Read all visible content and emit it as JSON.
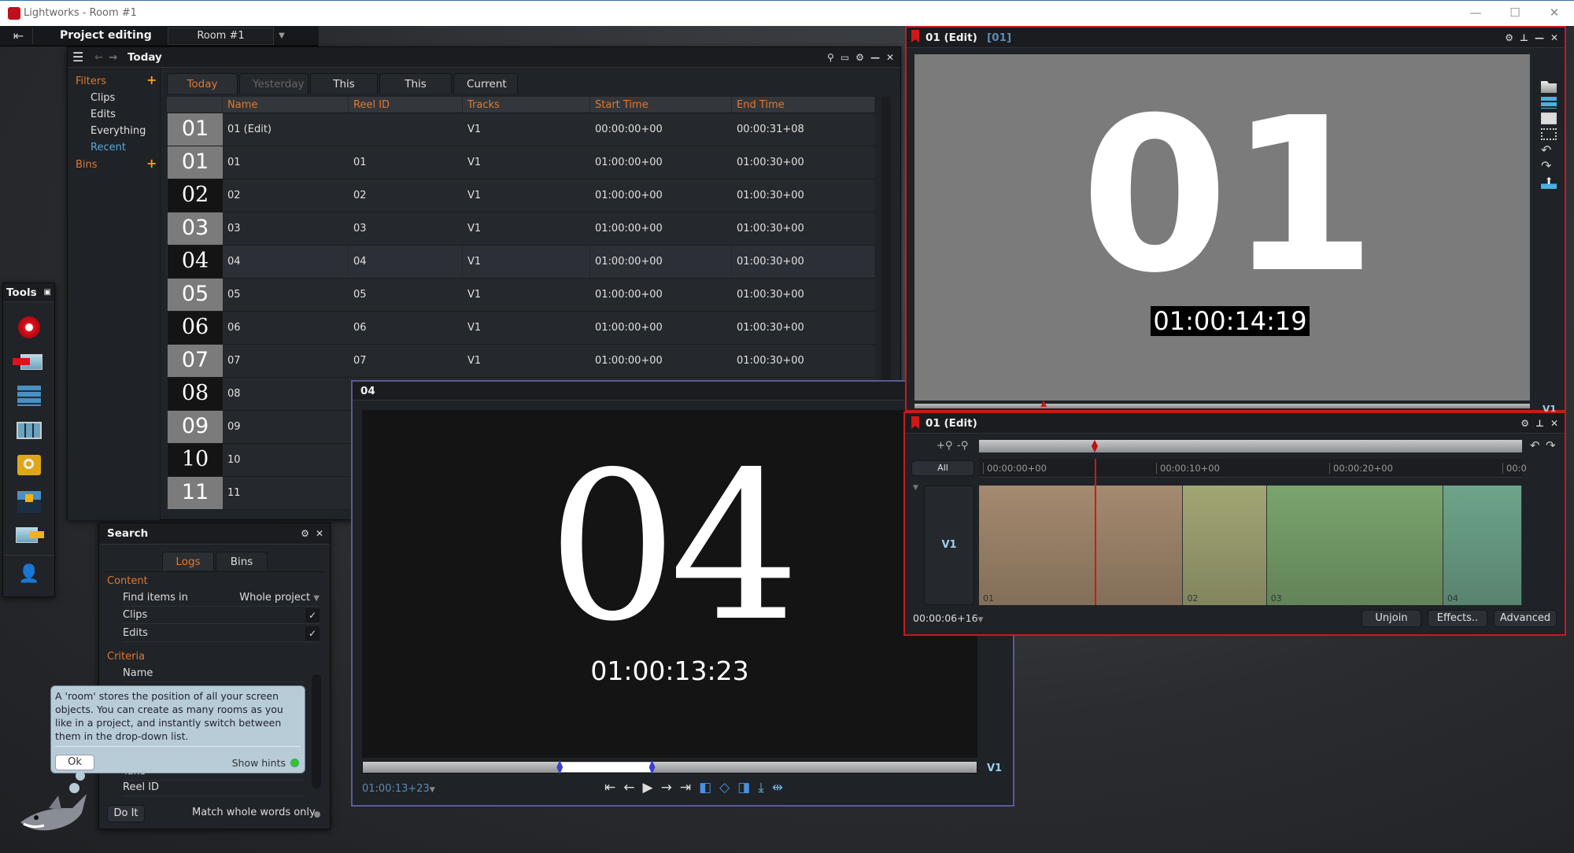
{
  "window": {
    "title": "Lightworks - Room #1",
    "minimize": "—",
    "maximize": "☐",
    "close": "✕"
  },
  "topbar": {
    "exit_icon": "⇤",
    "project_label": "Project editing",
    "room": "Room #1",
    "room_dropdown": "▼"
  },
  "browser": {
    "title": "Today",
    "header_icons": {
      "menu": "☰",
      "back": "←",
      "forward": "→",
      "search": "🔍",
      "view": "▭",
      "settings": "⚙",
      "minimize": "—",
      "close": "✕"
    },
    "filters": {
      "heading": "Filters",
      "add": "+",
      "items": [
        "Clips",
        "Edits",
        "Everything",
        "Recent"
      ],
      "active": "Recent",
      "bins_heading": "Bins",
      "bins_add": "+"
    },
    "tabs": [
      {
        "label": "Today",
        "state": "active"
      },
      {
        "label": "Yesterday",
        "state": "disabled"
      },
      {
        "label": "This week",
        "state": "normal"
      },
      {
        "label": "This month",
        "state": "normal"
      },
      {
        "label": "Current",
        "state": "normal"
      }
    ],
    "columns": [
      "",
      "Name",
      "Reel ID",
      "Tracks",
      "Start Time",
      "End Time"
    ],
    "rows": [
      {
        "thumb": "01",
        "thumb_style": "g",
        "flag": true,
        "name": "01 (Edit)",
        "reel": "",
        "tracks": "V1",
        "start": "00:00:00+00",
        "end": "00:00:31+08"
      },
      {
        "thumb": "01",
        "thumb_style": "g",
        "name": "01",
        "reel": "01",
        "tracks": "V1",
        "start": "01:00:00+00",
        "end": "01:00:30+00"
      },
      {
        "thumb": "02",
        "thumb_style": "b",
        "name": "02",
        "reel": "02",
        "tracks": "V1",
        "start": "01:00:00+00",
        "end": "01:00:30+00"
      },
      {
        "thumb": "03",
        "thumb_style": "g",
        "name": "03",
        "reel": "03",
        "tracks": "V1",
        "start": "01:00:00+00",
        "end": "01:00:30+00"
      },
      {
        "thumb": "04",
        "thumb_style": "b",
        "name": "04",
        "reel": "04",
        "tracks": "V1",
        "start": "01:00:00+00",
        "end": "01:00:30+00"
      },
      {
        "thumb": "05",
        "thumb_style": "g",
        "name": "05",
        "reel": "05",
        "tracks": "V1",
        "start": "01:00:00+00",
        "end": "01:00:30+00"
      },
      {
        "thumb": "06",
        "thumb_style": "b",
        "name": "06",
        "reel": "06",
        "tracks": "V1",
        "start": "01:00:00+00",
        "end": "01:00:30+00"
      },
      {
        "thumb": "07",
        "thumb_style": "g",
        "name": "07",
        "reel": "07",
        "tracks": "V1",
        "start": "01:00:00+00",
        "end": "01:00:30+00"
      },
      {
        "thumb": "08",
        "thumb_style": "b",
        "name": "08",
        "reel": "",
        "tracks": "",
        "start": "",
        "end": ""
      },
      {
        "thumb": "09",
        "thumb_style": "g",
        "name": "09",
        "reel": "",
        "tracks": "",
        "start": "",
        "end": ""
      },
      {
        "thumb": "10",
        "thumb_style": "b",
        "name": "10",
        "reel": "",
        "tracks": "",
        "start": "",
        "end": ""
      },
      {
        "thumb": "11",
        "thumb_style": "g",
        "name": "11",
        "reel": "",
        "tracks": "",
        "start": "",
        "end": ""
      }
    ]
  },
  "tools": {
    "title": "Tools",
    "pin": "⌅",
    "items": [
      "record-icon",
      "import-icon",
      "sync-icon",
      "board-icon",
      "search-folder-icon",
      "export-timeline-icon",
      "export-icon",
      "user-settings-icon"
    ]
  },
  "search": {
    "title": "Search",
    "tabs": [
      "Logs",
      "Bins"
    ],
    "active_tab": "Logs",
    "content_heading": "Content",
    "find_label": "Find items in",
    "find_value": "Whole project",
    "clips_label": "Clips",
    "clips_checked": "✓",
    "edits_label": "Edits",
    "edits_checked": "✓",
    "criteria_heading": "Criteria",
    "criteria_fields": [
      "Name",
      "Take",
      "Reel ID"
    ],
    "do_it": "Do It",
    "match_whole": "Match whole words only"
  },
  "hint": {
    "text": "A 'room' stores the position of all your screen objects.  You can create as many rooms as you like in a project, and instantly switch between them in the drop-down list.",
    "ok": "Ok",
    "show_hints": "Show hints",
    "show_hints_on": true
  },
  "viewer_source": {
    "title": "04",
    "frame_number": "04",
    "frame_timecode": "01:00:13:23",
    "timecode": "01:00:13+23",
    "timecode_dd": "▼",
    "track": "V1",
    "mark_in_fraction": 0.32,
    "mark_out_fraction": 0.47,
    "transport": [
      "⇤",
      "←",
      "▶",
      "→",
      "⇥"
    ]
  },
  "viewer_record": {
    "title": "01 (Edit)",
    "subtitle": "[01]",
    "frame_number": "01",
    "frame_timecode": "01:00:14:19",
    "track": "V1",
    "playhead_fraction": 0.21
  },
  "timeline": {
    "title": "01 (Edit)",
    "zoom_in": "+⚲",
    "zoom_out": "-⚲",
    "all_label": "All",
    "ruler": [
      "00:00:00+00",
      "00:00:10+00",
      "00:00:20+00",
      "00:0"
    ],
    "track": "V1",
    "clips": [
      {
        "label": "01",
        "start_fraction": 0.0,
        "end_fraction": 0.376,
        "color": "#a48a6f"
      },
      {
        "label": "02",
        "start_fraction": 0.376,
        "end_fraction": 0.53,
        "color": "#a2a674"
      },
      {
        "label": "03",
        "start_fraction": 0.53,
        "end_fraction": 0.855,
        "color": "#7aa46e"
      },
      {
        "label": "04",
        "start_fraction": 0.855,
        "end_fraction": 1.0,
        "color": "#6ea48a"
      }
    ],
    "playhead_fraction": 0.213,
    "timecode": "00:00:06+16",
    "timecode_dd": "▼",
    "buttons": [
      "Unjoin",
      "Effects..",
      "Advanced"
    ]
  },
  "colors": {
    "accent_orange": "#e0782f",
    "record_red": "#c41c1c",
    "source_border": "#5b5a95",
    "link_blue": "#5ba7dd"
  }
}
